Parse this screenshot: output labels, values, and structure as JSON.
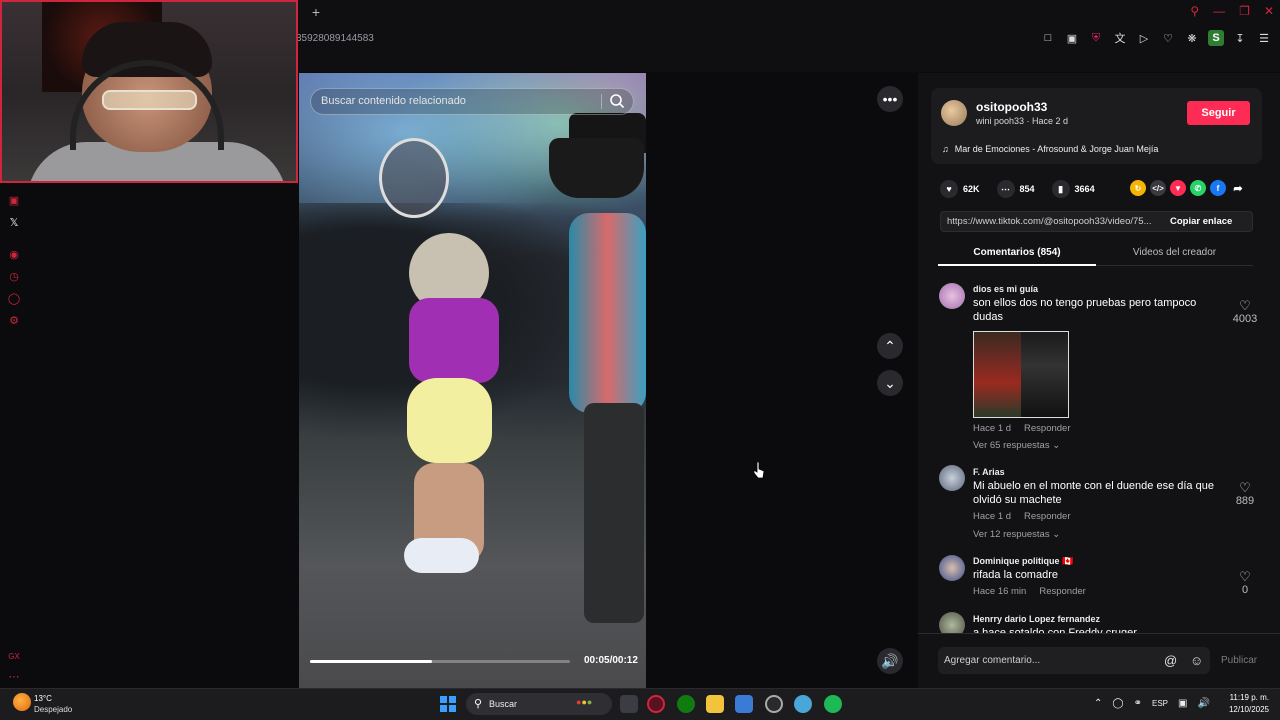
{
  "browser": {
    "new_tab_label": "+",
    "url_fragment": "35928089144583",
    "window_controls": [
      "search-icon",
      "minimize-icon",
      "restore-icon",
      "close-icon"
    ],
    "extensions": [
      "bookmark-icon",
      "snapshot-icon",
      "shield-icon",
      "translate-icon",
      "send-icon",
      "heart-icon",
      "extensions-icon",
      "profile-icon",
      "download-icon",
      "menu-icon"
    ],
    "profile_letter": "S"
  },
  "sidebar": {
    "items": [
      "instagram-icon",
      "x-icon",
      "player-icon",
      "history-icon",
      "messenger-icon",
      "settings-icon"
    ],
    "bottom": [
      "gx-icon",
      "more-icon"
    ]
  },
  "video": {
    "search_placeholder": "Buscar contenido relacionado",
    "time": "00:05/00:12",
    "progress": 0.47
  },
  "author": {
    "username": "ositopooh33",
    "subtitle": "wini pooh33 · Hace 2 d",
    "follow_label": "Seguir",
    "music": "Mar de Emociones - Afrosound & Jorge Juan Mejía"
  },
  "stats": {
    "likes": "62K",
    "comments": "854",
    "saves": "3664"
  },
  "share": {
    "link": "https://www.tiktok.com/@ositopooh33/video/75...",
    "copy_label": "Copiar enlace",
    "colors": [
      "#f5b400",
      "#3a3a3e",
      "#fe2c55",
      "#25d366",
      "#1877f2"
    ]
  },
  "tabs": {
    "comments": "Comentarios (854)",
    "creator_videos": "Videos del creador"
  },
  "comments": [
    {
      "name": "dios es mi guía",
      "text": "son ellos dos no tengo pruebas pero tampoco dudas",
      "time": "Hace 1 d",
      "reply": "Responder",
      "replies": "Ver 65 respuestas",
      "likes": "4003"
    },
    {
      "name": "F. Arias",
      "text": "Mi abuelo en el monte con el duende ese día que olvidó su machete",
      "time": "Hace 1 d",
      "reply": "Responder",
      "replies": "Ver 12 respuestas",
      "likes": "889"
    },
    {
      "name": "Dominique politique 🇨🇦",
      "text": "rifada la comadre",
      "time": "Hace 16 min",
      "reply": "Responder",
      "likes": "0"
    },
    {
      "name": "Henrry dario Lopez fernandez",
      "text": "a hace sotaldo con Freddy cruger"
    }
  ],
  "comment_box": {
    "placeholder": "Agregar comentario...",
    "publish": "Publicar"
  },
  "taskbar": {
    "weather_temp": "13°C",
    "weather_desc": "Despejado",
    "search": "Buscar",
    "language": "ESP",
    "time": "11:19 p. m.",
    "date": "12/10/2025"
  }
}
